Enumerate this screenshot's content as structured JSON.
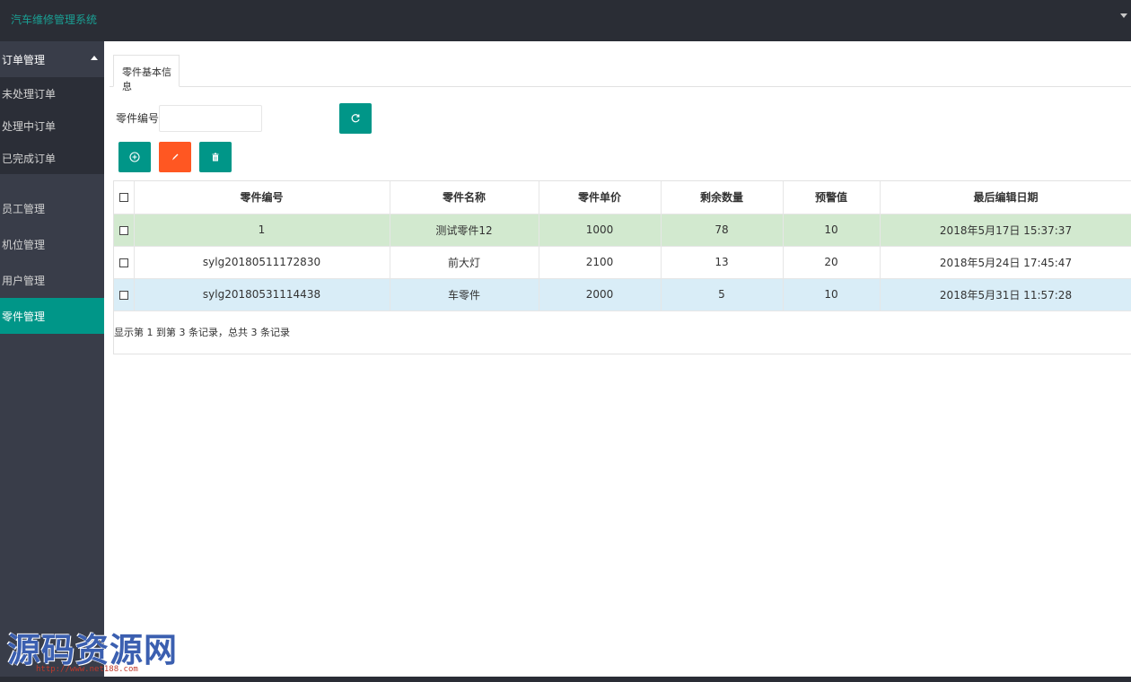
{
  "app": {
    "title": "汽车维修管理系统"
  },
  "sidebar": {
    "group": {
      "label": "订单管理",
      "items": [
        {
          "label": "未处理订单"
        },
        {
          "label": "处理中订单"
        },
        {
          "label": "已完成订单"
        }
      ]
    },
    "items": [
      {
        "label": "员工管理"
      },
      {
        "label": "机位管理"
      },
      {
        "label": "用户管理"
      },
      {
        "label": "零件管理",
        "active": true
      }
    ]
  },
  "tabs": [
    {
      "label": "零件基本信息",
      "active": true
    }
  ],
  "search": {
    "label": "零件编号:",
    "value": "",
    "placeholder": ""
  },
  "toolbar": {
    "refresh_icon": "refresh-icon",
    "add_icon": "add-circle-icon",
    "edit_icon": "pencil-icon",
    "delete_icon": "trash-icon"
  },
  "table": {
    "headers": [
      "零件编号",
      "零件名称",
      "零件单价",
      "剩余数量",
      "预警值",
      "最后编辑日期"
    ],
    "rows": [
      {
        "cells": [
          "1",
          "测试零件12",
          "1000",
          "78",
          "10",
          "2018年5月17日 15:37:37"
        ],
        "checked": false
      },
      {
        "cells": [
          "sylg20180511172830",
          "前大灯",
          "2100",
          "13",
          "20",
          "2018年5月24日 17:45:47"
        ],
        "checked": false
      },
      {
        "cells": [
          "sylg20180531114438",
          "车零件",
          "2000",
          "5",
          "10",
          "2018年5月31日 11:57:28"
        ],
        "checked": false
      }
    ],
    "pagination_info": "显示第 1 到第 3 条记录，总共 3 条记录"
  },
  "watermark": {
    "title": "源码资源网",
    "url": "http://www.net188.com"
  },
  "colors": {
    "topbar": "#2a2d35",
    "sidebar": "#393d49",
    "submenu": "#2b2e37",
    "accent": "#009688",
    "danger": "#ff5722",
    "row_green": "#d2e9cf",
    "row_blue": "#d9edf7"
  }
}
